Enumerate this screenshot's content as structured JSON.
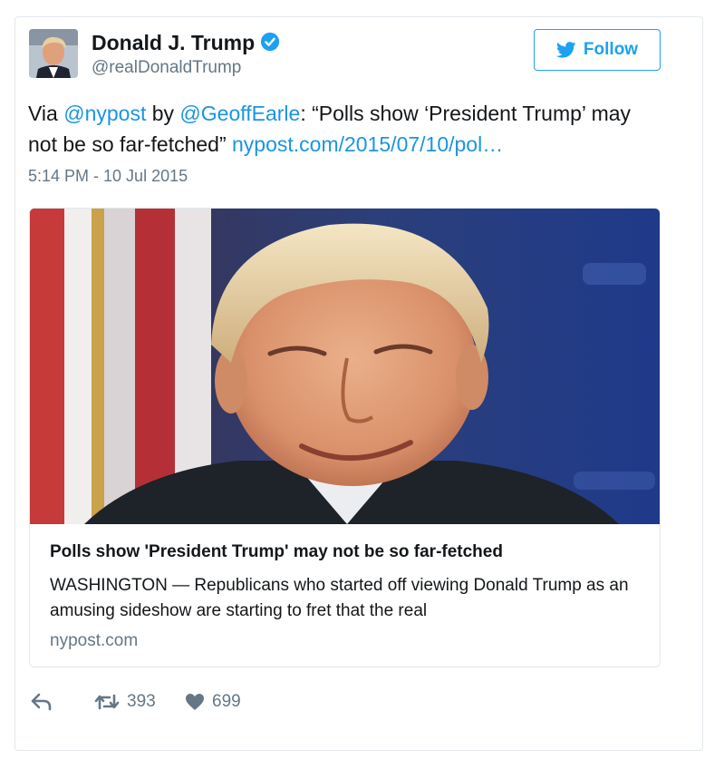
{
  "user": {
    "name": "Donald J. Trump",
    "handle": "@realDonaldTrump",
    "verified": true,
    "avatar_icon": "profile-photo"
  },
  "follow": {
    "label": "Follow",
    "icon": "twitter-bird-icon",
    "color": "#1da1f2"
  },
  "tweet": {
    "segments": [
      {
        "text": "Via ",
        "type": "text"
      },
      {
        "text": "@nypost",
        "type": "link"
      },
      {
        "text": " by ",
        "type": "text"
      },
      {
        "text": "@GeoffEarle",
        "type": "link"
      },
      {
        "text": ": “Polls show ‘President Trump’ may not be so far-fetched” ",
        "type": "text"
      },
      {
        "text": "nypost.com/2015/07/10/pol…",
        "type": "link"
      }
    ],
    "timestamp": "5:14 PM - 10 Jul 2015",
    "link_color": "#1b95e0"
  },
  "link_card": {
    "image_icon": "photo-of-smiling-man",
    "title": "Polls show 'President Trump' may not be so far-fetched",
    "description": "WASHINGTON — Republicans who started off viewing Donald Trump as an amusing sideshow are starting to fret that the real",
    "domain": "nypost.com"
  },
  "actions": {
    "reply_icon": "reply-icon",
    "retweet_icon": "retweet-icon",
    "retweet_count": "393",
    "like_icon": "heart-icon",
    "like_count": "699"
  }
}
